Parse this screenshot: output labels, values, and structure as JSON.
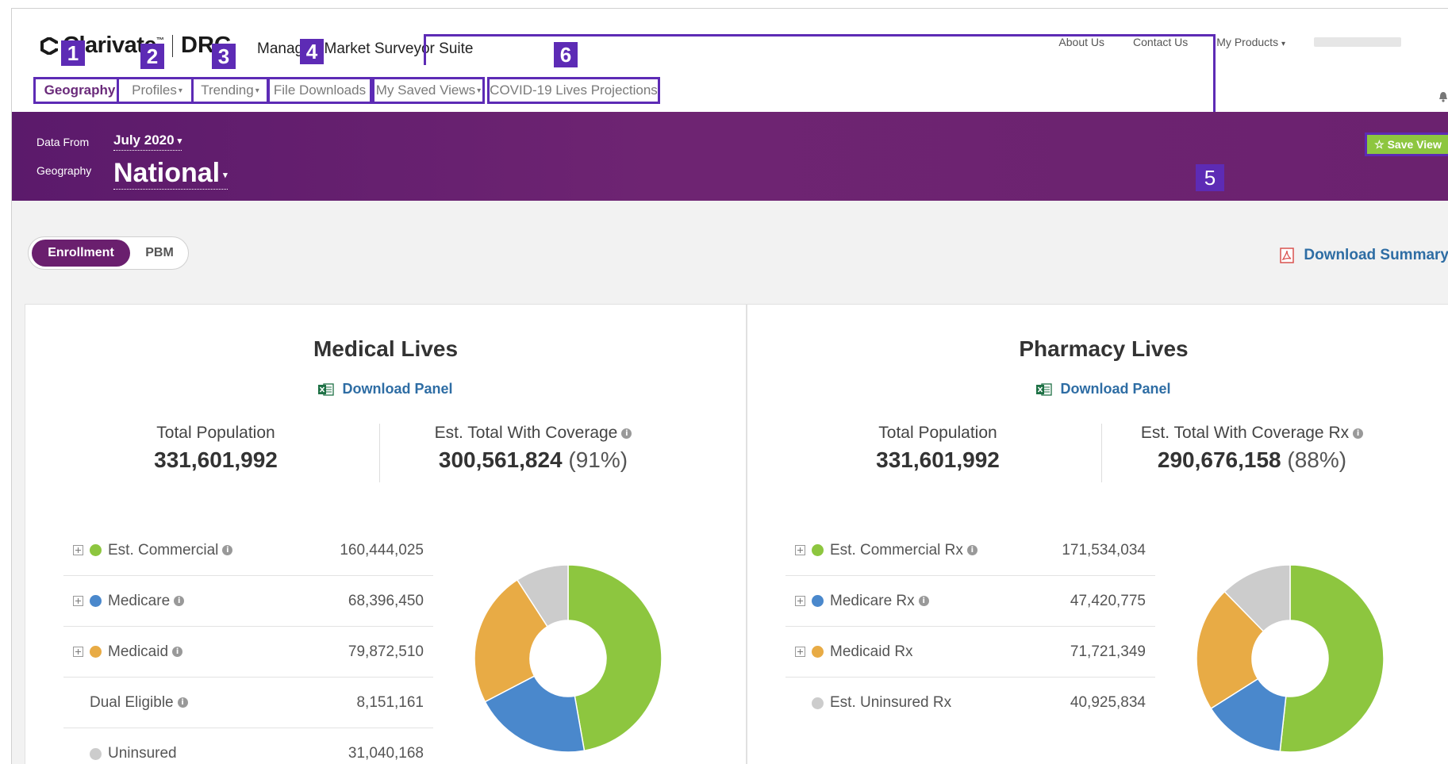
{
  "header": {
    "brand": "Clarivate",
    "brand_tm": "™",
    "brand_sub": "DRG",
    "suite_title": "Managed Market Surveyor Suite",
    "links": [
      "About Us",
      "Contact Us",
      "My Products"
    ],
    "my_products_caret": "▾"
  },
  "nav": {
    "items": [
      {
        "label": "Geography",
        "badge": "1"
      },
      {
        "label": "Profiles",
        "badge": "2"
      },
      {
        "label": "Trending",
        "badge": "3"
      },
      {
        "label": "File Downloads",
        "badge": "4"
      },
      {
        "label": "My Saved Views",
        "badge": ""
      },
      {
        "label": "COVID-19 Lives Projections",
        "badge": "6"
      }
    ],
    "caret": "▾"
  },
  "filters": {
    "data_from_label": "Data From",
    "data_from_value": "July 2020",
    "geography_label": "Geography",
    "geography_value": "National",
    "save_view_label": "☆ Save View",
    "save_view_badge": "5"
  },
  "toggle": {
    "enrollment": "Enrollment",
    "pbm": "PBM"
  },
  "download_summary": "Download Summary",
  "colors": {
    "purple": "#6b226f",
    "annotation": "#5d2bb5",
    "commercial": "#8dc63f",
    "medicare": "#4a88cc",
    "medicaid": "#e8ab45",
    "uninsured": "#cccccc"
  },
  "medical": {
    "title": "Medical Lives",
    "download": "Download Panel",
    "total_population_label": "Total Population",
    "total_population": "331,601,992",
    "coverage_label": "Est. Total With Coverage",
    "coverage_value": "300,561,824",
    "coverage_pct": "(91%)",
    "rows": [
      {
        "label": "Est. Commercial",
        "value": "160,444,025"
      },
      {
        "label": "Medicare",
        "value": "68,396,450"
      },
      {
        "label": "Medicaid",
        "value": "79,872,510"
      },
      {
        "label": "Dual Eligible",
        "value": "8,151,161"
      },
      {
        "label": "Uninsured",
        "value": "31,040,168"
      }
    ]
  },
  "pharmacy": {
    "title": "Pharmacy Lives",
    "download": "Download Panel",
    "total_population_label": "Total Population",
    "total_population": "331,601,992",
    "coverage_label": "Est. Total With Coverage Rx",
    "coverage_value": "290,676,158",
    "coverage_pct": "(88%)",
    "rows": [
      {
        "label": "Est. Commercial Rx",
        "value": "171,534,034"
      },
      {
        "label": "Medicare Rx",
        "value": "47,420,775"
      },
      {
        "label": "Medicaid Rx",
        "value": "71,721,349"
      },
      {
        "label": "Est. Uninsured Rx",
        "value": "40,925,834"
      }
    ]
  },
  "chart_data": [
    {
      "type": "pie",
      "categories": [
        "Est. Commercial",
        "Medicare",
        "Medicaid",
        "Uninsured"
      ],
      "values": [
        160444025,
        68396450,
        79872510,
        31040168
      ]
    },
    {
      "type": "pie",
      "categories": [
        "Est. Commercial Rx",
        "Medicare Rx",
        "Medicaid Rx",
        "Est. Uninsured Rx"
      ],
      "values": [
        171534034,
        47420775,
        71721349,
        40925834
      ]
    }
  ]
}
